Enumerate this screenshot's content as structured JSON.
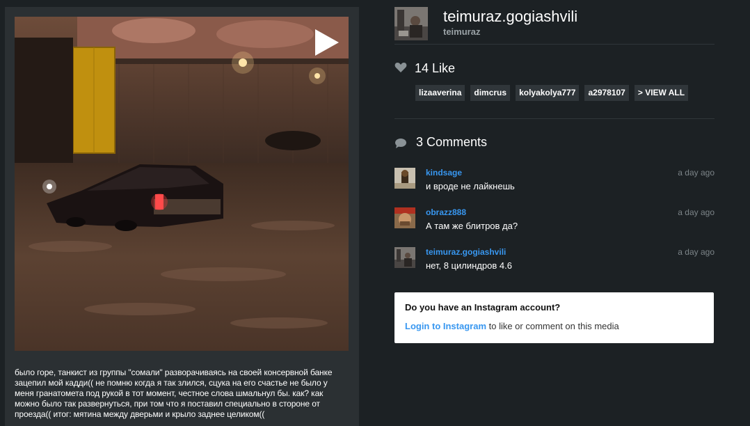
{
  "post": {
    "caption": "было горе, танкист из группы \"сомали\" разворачиваясь на своей консервной банке зацепил мой кадди(( не помню когда я так злился, сцука на его счастье не было у меня гранатомета под рукой в тот момент, честное слова шмальнул бы. как? как можно было так развернуться, при том что я поставил специально в стороне от проезда(( итог: мятина между дверьми и крыло заднее целиком(("
  },
  "user": {
    "username": "teimuraz.gogiashvili",
    "full_name": "teimuraz"
  },
  "likes": {
    "count_label": "14 Like",
    "likers": [
      "lizaaverina",
      "dimcrus",
      "kolyakolya777",
      "a2978107"
    ],
    "view_all_label": "> VIEW ALL"
  },
  "comments": {
    "count_label": "3 Comments",
    "items": [
      {
        "user": "kindsage",
        "time": "a day ago",
        "text": "и вроде не лайкнешь"
      },
      {
        "user": "obrazz888",
        "time": "a day ago",
        "text": "А там же блитров да?"
      },
      {
        "user": "teimuraz.gogiashvili",
        "time": "a day ago",
        "text": "нет, 8 цилиндров 4.6"
      }
    ]
  },
  "login_prompt": {
    "title": "Do you have an Instagram account?",
    "link_label": "Login to Instagram",
    "suffix": " to like or comment on this media"
  },
  "colors": {
    "background": "#1c2124",
    "panel": "#2b3033",
    "link": "#3897f0"
  }
}
